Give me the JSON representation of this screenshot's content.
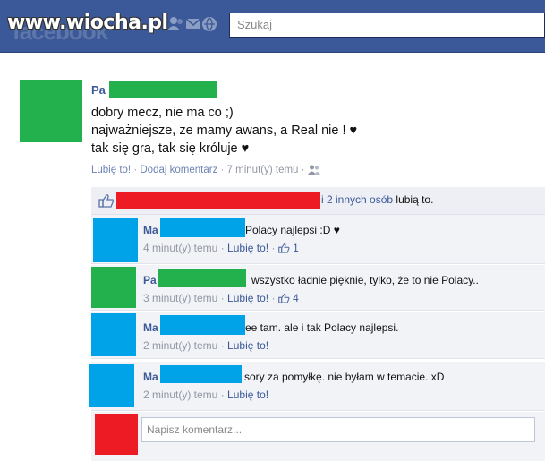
{
  "header": {
    "watermark": "www.wiocha.pl",
    "logo_faded": "facebook",
    "search_placeholder": "Szukaj",
    "icons": [
      "friends-icon",
      "messages-icon",
      "notifications-icon"
    ]
  },
  "post": {
    "author_prefix": "Pa",
    "lines": [
      "dobry mecz, nie ma co ;)",
      "najważniejsze, ze mamy awans, a Real nie ! ♥",
      "tak się gra, tak się króluje ♥"
    ],
    "like_label": "Lubię to!",
    "comment_label": "Dodaj komentarz",
    "time": "7 minut(y) temu",
    "separator": "·",
    "audience_icon": "friends-audience-icon"
  },
  "likes": {
    "others_link": "i 2 innych osób",
    "suffix": "lubią to."
  },
  "comments": [
    {
      "author_prefix": "Ma",
      "text": "Polacy najlepsi :D ♥",
      "time": "4 minut(y) temu",
      "like_label": "Lubię to!",
      "likes": "1"
    },
    {
      "author_prefix": "Pa",
      "text": "wszystko ładnie pięknie, tylko, że to nie Polacy..",
      "time": "3 minut(y) temu",
      "like_label": "Lubię to!",
      "likes": "4"
    },
    {
      "author_prefix": "Ma",
      "text": "ee tam. ale i tak Polacy najlepsi.",
      "time": "2 minut(y) temu",
      "like_label": "Lubię to!"
    },
    {
      "author_prefix": "Ma",
      "text": "sory za pomyłkę. nie byłam w temacie. xD",
      "time": "2 minut(y) temu",
      "like_label": "Lubię to!"
    }
  ],
  "new_comment": {
    "placeholder": "Napisz komentarz..."
  },
  "colors": {
    "facebook_blue": "#3b5998",
    "link_blue": "#3b5998",
    "meta_gray": "#9197a3",
    "redact_green": "#22b14c",
    "redact_blue": "#00a2e8",
    "redact_red": "#ed1c24",
    "likes_bg": "#edeff4",
    "comment_bg": "#f2f3f7"
  }
}
